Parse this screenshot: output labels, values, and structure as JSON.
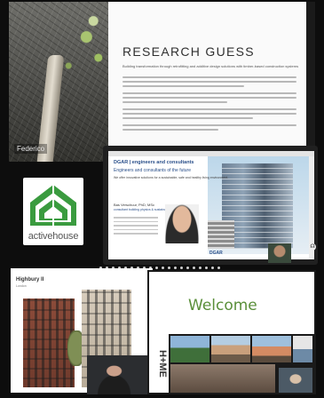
{
  "tiles": {
    "research": {
      "presenter_label": "Federico",
      "slide_title": "RESEARCH GUESS",
      "slide_subtitle": "Building transformation through retrofitting and additive design solutions with timber-based construction systems"
    },
    "logo": {
      "wordmark": "activehouse",
      "brand_color": "#3a9b3f"
    },
    "dgar": {
      "heading": "DGAR | engineers and consultants",
      "tagline": "Engineers and consultants of the future",
      "mission": "We offer innovative solutions for a sustainable, safe and healthy living environment.",
      "person_name": "Bas Verschuur, PhD, MSc",
      "person_role": "consultant building physics & sustainability",
      "small_logo": "DGAR",
      "toolbar_icon": "headset-icon"
    },
    "highbury": {
      "title": "Highbury II",
      "subtitle": "London"
    },
    "welcome": {
      "title": "Welcome",
      "brand_logo": "H+ME",
      "accent_color": "#5a8f3a"
    }
  }
}
